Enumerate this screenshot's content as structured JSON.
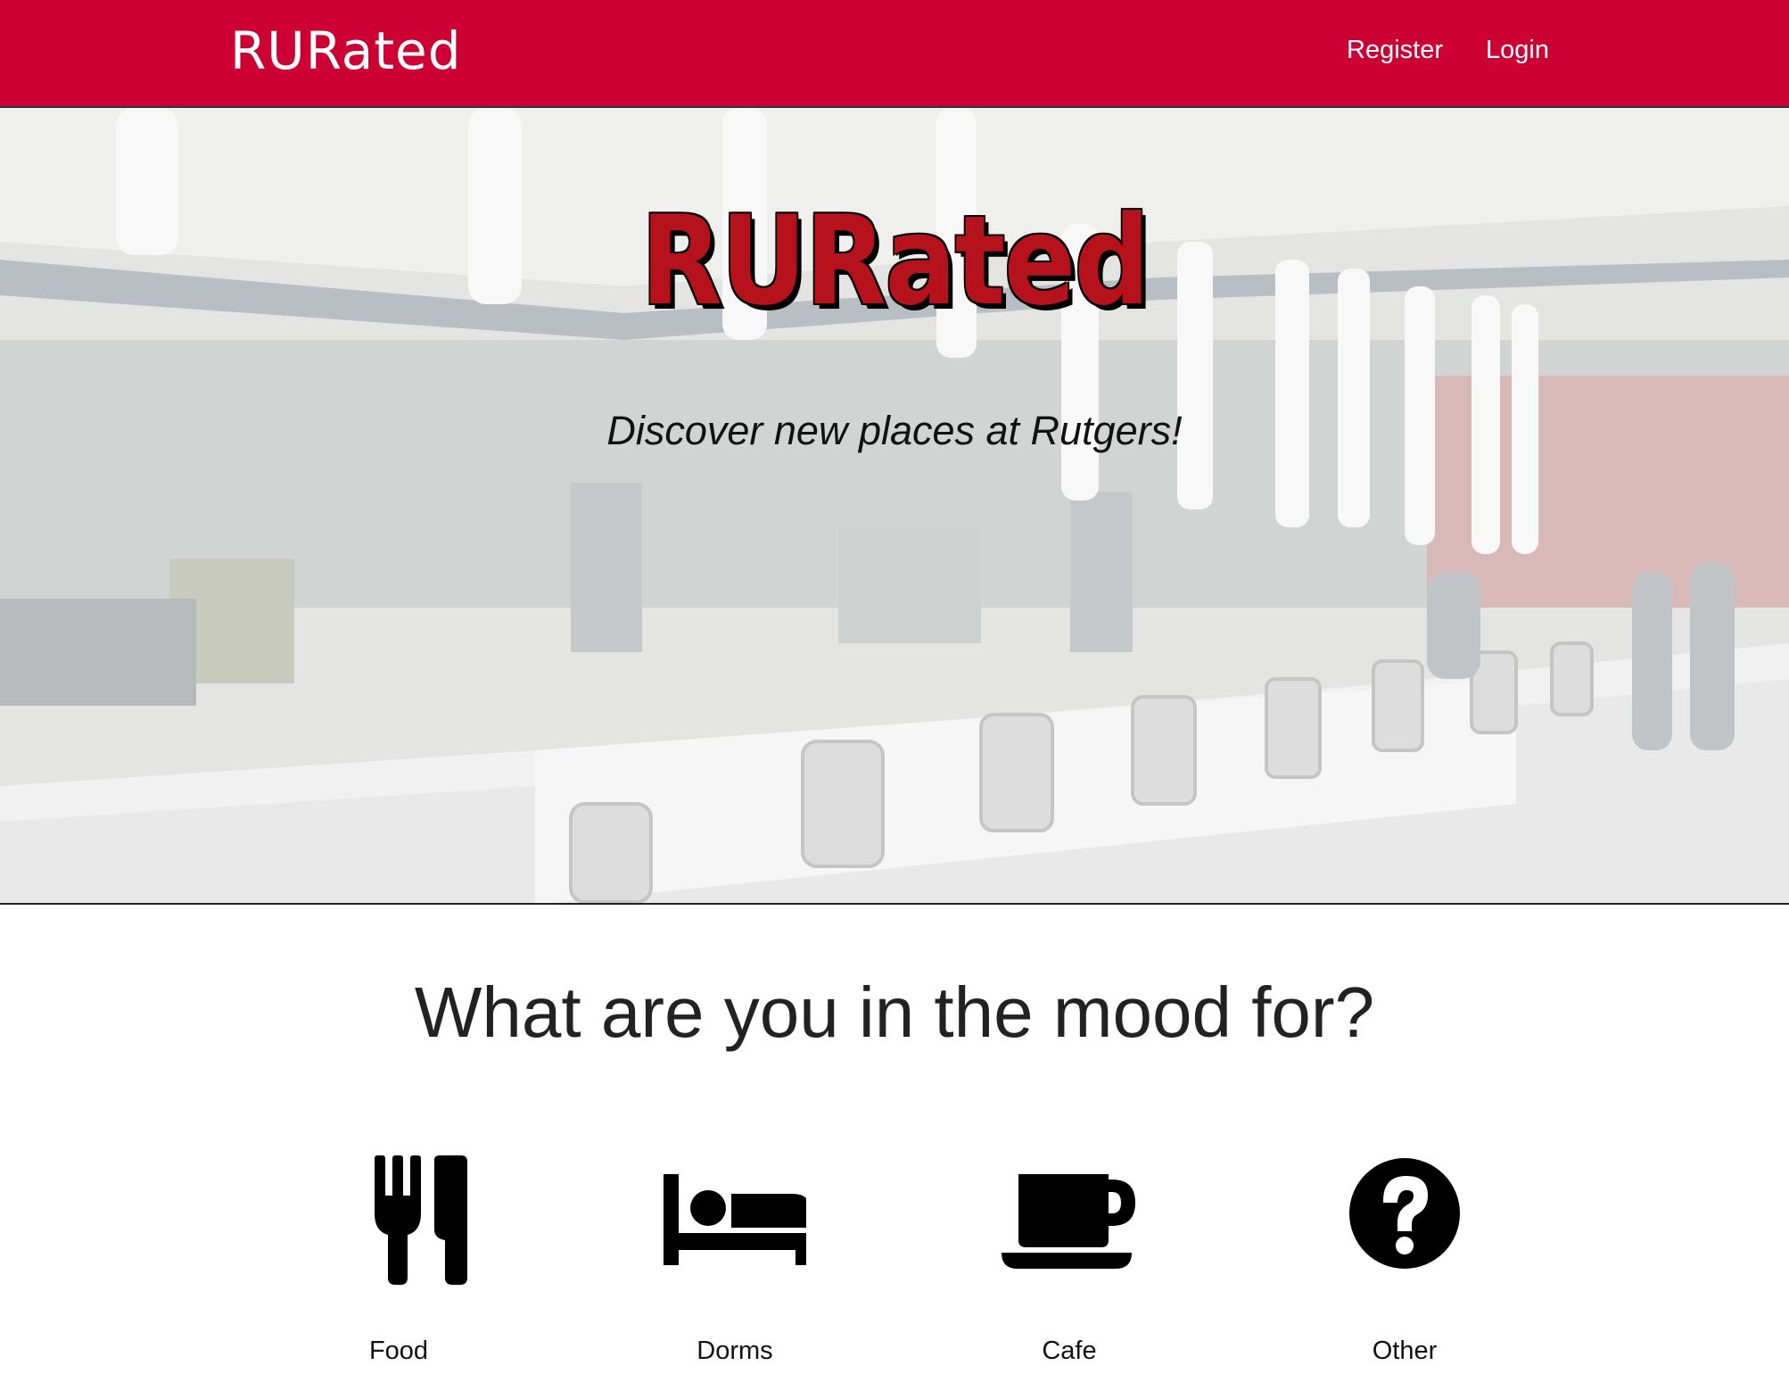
{
  "navbar": {
    "brand": "RURated",
    "links": {
      "register": "Register",
      "login": "Login"
    },
    "color": "#cc0033"
  },
  "hero": {
    "title": "RURated",
    "tagline": "Discover new places at Rutgers!",
    "title_color": "#b5121b",
    "background": "dining-hall-photo"
  },
  "mood": {
    "heading": "What are you in the mood for?",
    "categories": [
      {
        "label": "Food",
        "icon": "fork-knife-icon"
      },
      {
        "label": "Dorms",
        "icon": "bed-icon"
      },
      {
        "label": "Cafe",
        "icon": "coffee-cup-icon"
      },
      {
        "label": "Other",
        "icon": "question-circle-icon"
      }
    ]
  }
}
